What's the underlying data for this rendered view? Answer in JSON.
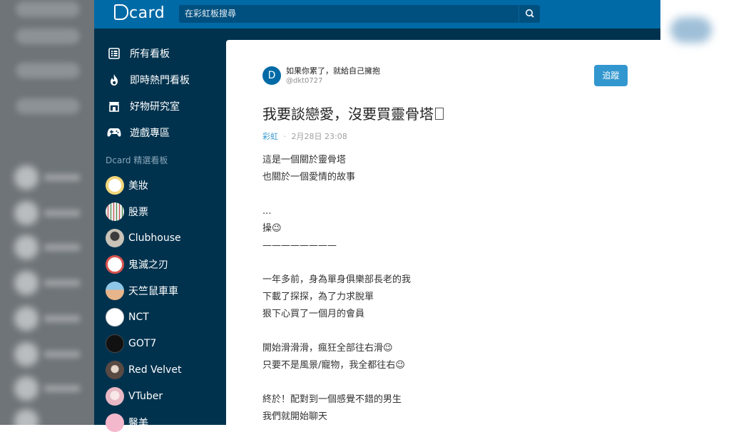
{
  "header": {
    "logo_text": "card",
    "search_placeholder": "在彩虹板搜尋"
  },
  "sidebar": {
    "nav": [
      {
        "label": "所有看板",
        "icon": "list-icon"
      },
      {
        "label": "即時熱門看板",
        "icon": "fire-icon"
      },
      {
        "label": "好物研究室",
        "icon": "store-icon"
      },
      {
        "label": "遊戲專區",
        "icon": "gamepad-icon"
      }
    ],
    "section_title": "Dcard 精選看板",
    "boards": [
      {
        "label": "美妝",
        "color": "#f2d77a"
      },
      {
        "label": "股票",
        "color": "#e8e8e8"
      },
      {
        "label": "Clubhouse",
        "color": "#c9c3b8"
      },
      {
        "label": "鬼滅之刃",
        "color": "#d9534f"
      },
      {
        "label": "天竺鼠車車",
        "color": "#e8b48a"
      },
      {
        "label": "NCT",
        "color": "#ffffff"
      },
      {
        "label": "GOT7",
        "color": "#111111"
      },
      {
        "label": "Red Velvet",
        "color": "#9a8a80"
      },
      {
        "label": "VTuber",
        "color": "#f0d0d8"
      },
      {
        "label": "醫美",
        "color": "#f4b8cc"
      }
    ]
  },
  "post": {
    "author_initial": "D",
    "author_name": "如果你累了，就給自己擁抱",
    "author_id": "@dkt0727",
    "follow_label": "追蹤",
    "title": "我要談戀愛，沒要買靈骨塔",
    "board": "彩虹",
    "separator": "·",
    "date": "2月28日 23:08",
    "body_lines": [
      "這是一個關於靈骨塔",
      "也關於一個愛情的故事",
      "",
      "...",
      "操😉",
      "————————",
      "",
      "一年多前，身為單身俱樂部長老的我",
      "下載了探探，為了力求脫單",
      "狠下心買了一個月的會員",
      "",
      "開始滑滑滑，瘋狂全部往右滑😉",
      "只要不是風景/寵物，我全都往右😉",
      "",
      "終於！配對到一個感覺不錯的男生",
      "我們就開始聊天"
    ]
  }
}
